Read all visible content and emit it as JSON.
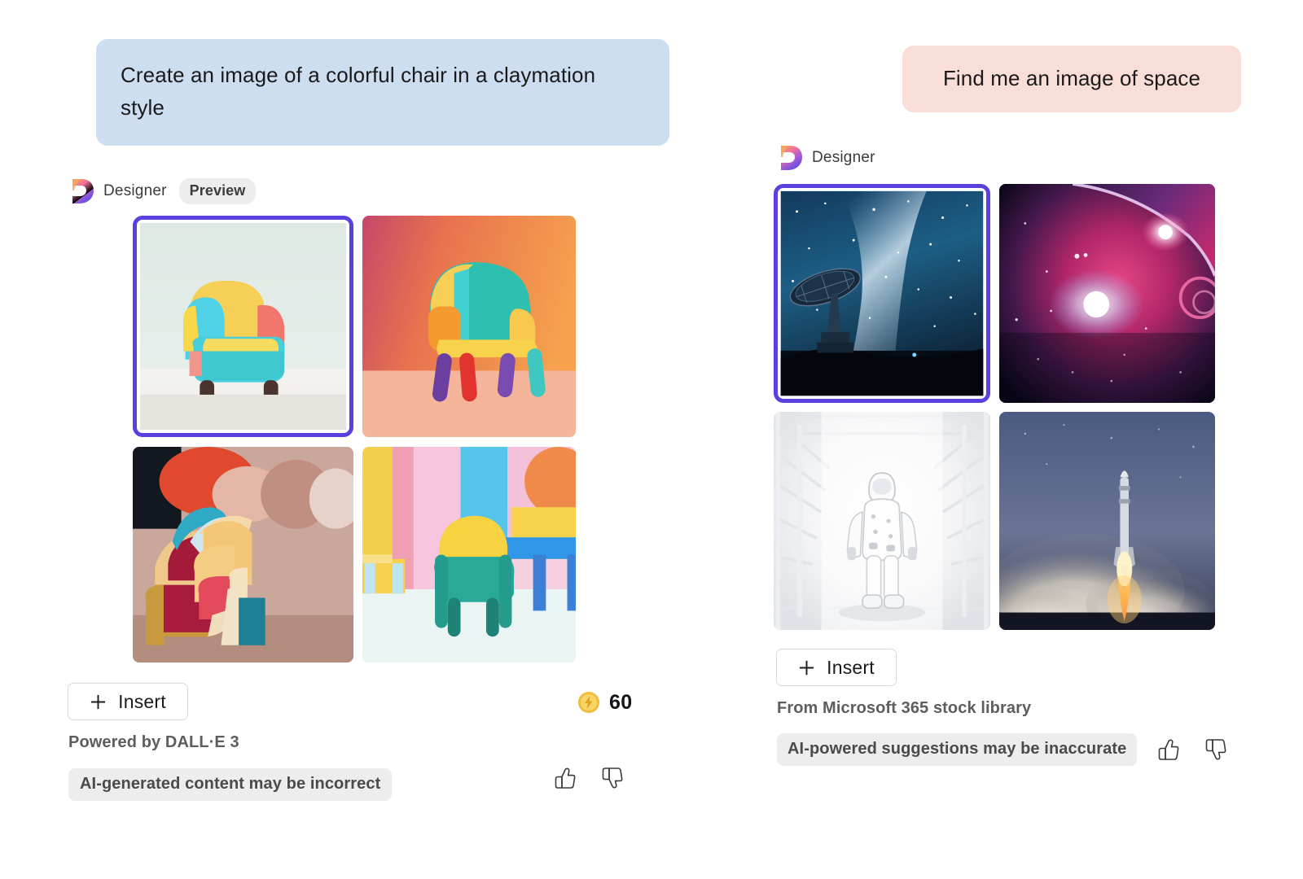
{
  "left_panel": {
    "prompt": "Create an image of a colorful chair in a claymation style",
    "provider": {
      "logo_icon": "designer-logo-icon",
      "name": "Designer",
      "badge": "Preview"
    },
    "images": [
      {
        "alt": "Claymation armchair in yellow, cyan, coral on pale mint background",
        "selected": true
      },
      {
        "alt": "Claymation chair in teal, orange, yellow on warm gradient background",
        "selected": false
      },
      {
        "alt": "Close-up claymation armchair in crimson, cream, teal",
        "selected": false
      },
      {
        "alt": "Small yellow and teal claymation chair in pastel room",
        "selected": false
      }
    ],
    "insert": {
      "icon": "plus-icon",
      "label": "Insert"
    },
    "credits": {
      "icon": "coin-icon",
      "value": "60"
    },
    "source_note": "Powered by DALL·E 3",
    "disclaimer": "AI-generated content may be incorrect",
    "feedback": [
      {
        "icon": "thumbs-up-icon",
        "name": "thumbs-up-button"
      },
      {
        "icon": "thumbs-down-icon",
        "name": "thumbs-down-button"
      }
    ]
  },
  "right_panel": {
    "prompt": "Find me an image of space",
    "provider": {
      "logo_icon": "designer-logo-icon",
      "name": "Designer"
    },
    "images": [
      {
        "alt": "Radio telescope dish silhouetted against the Milky Way",
        "selected": true
      },
      {
        "alt": "Purple and magenta nebula with bright planet limb",
        "selected": false
      },
      {
        "alt": "Astronaut standing in a bright white corridor",
        "selected": false
      },
      {
        "alt": "Rocket launching at dusk with plume of smoke",
        "selected": false
      }
    ],
    "insert": {
      "icon": "plus-icon",
      "label": "Insert"
    },
    "source_note": "From Microsoft 365 stock library",
    "disclaimer": "AI-powered suggestions may be inaccurate",
    "feedback": [
      {
        "icon": "thumbs-up-icon",
        "name": "thumbs-up-button"
      },
      {
        "icon": "thumbs-down-icon",
        "name": "thumbs-down-button"
      }
    ]
  },
  "colors": {
    "prompt_bubble_left": "#cedef1",
    "prompt_bubble_right": "#f8ded6",
    "selection_border": "#5b3fe0",
    "pill_background": "#ededed",
    "page_background": "#ffffff",
    "coin_gold": "#f2c044"
  }
}
